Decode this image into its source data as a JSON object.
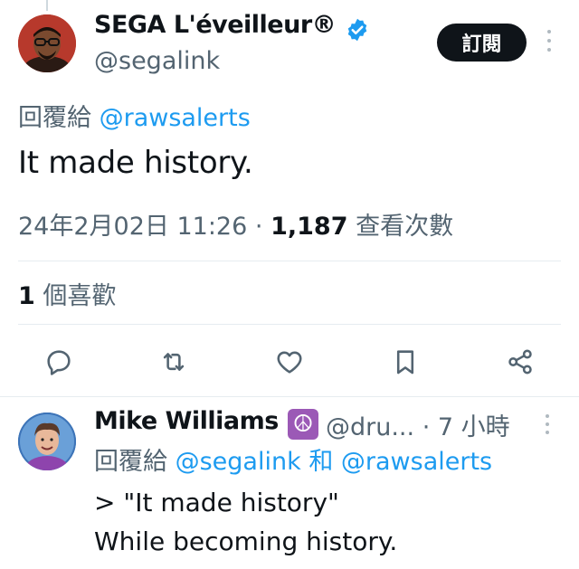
{
  "tweet": {
    "author_name": "SEGA L'éveilleur®",
    "handle": "@segalink",
    "subscribe_label": "訂閱",
    "reply_prefix": "回覆給",
    "reply_to": "@rawsalerts",
    "text": "It made history.",
    "timestamp": "24年2月02日 11:26",
    "separator": "·",
    "views_count": "1,187",
    "views_label": "查看次數",
    "likes_count": "1",
    "likes_label": "個喜歡"
  },
  "actions": [
    {
      "name": "reply-icon"
    },
    {
      "name": "retweet-icon"
    },
    {
      "name": "like-icon"
    },
    {
      "name": "bookmark-icon"
    },
    {
      "name": "share-icon"
    }
  ],
  "reply": {
    "author_name": "Mike Williams",
    "emoji": "☮",
    "handle": "@dru...",
    "time": "· 7 小時",
    "reply_prefix": "回覆給",
    "reply_to_1": "@segalink",
    "conjunction": "和",
    "reply_to_2": "@rawsalerts",
    "line1": "> \"It made history\"",
    "line2": "While becoming history."
  },
  "colors": {
    "accent": "#1d9bf0",
    "verified": "#1d9bf0",
    "text": "#0f1419",
    "secondary": "#536471",
    "peace_bg": "#9b59b6"
  }
}
